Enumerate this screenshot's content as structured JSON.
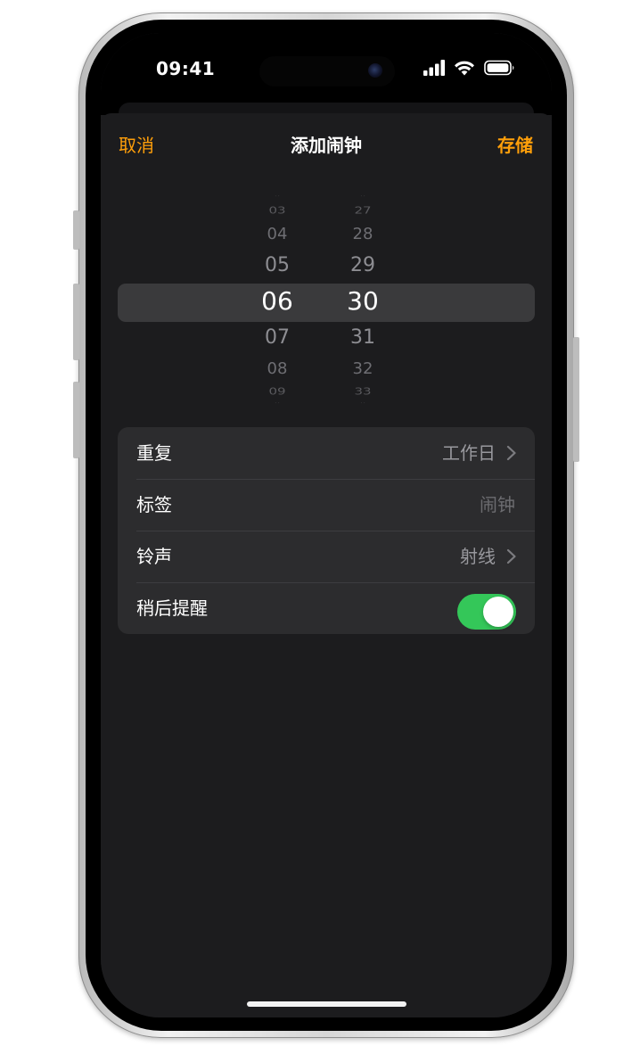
{
  "status_bar": {
    "time": "09:41",
    "icons": [
      "cellular-signal-icon",
      "wifi-icon",
      "battery-icon"
    ]
  },
  "nav": {
    "cancel_label": "取消",
    "title": "添加闹钟",
    "save_label": "存储"
  },
  "time_picker": {
    "hours": [
      "03",
      "04",
      "05",
      "06",
      "07",
      "08",
      "09"
    ],
    "minutes": [
      "27",
      "28",
      "29",
      "30",
      "31",
      "32",
      "33"
    ],
    "selected_hour": "06",
    "selected_minute": "30"
  },
  "settings": {
    "repeat": {
      "label": "重复",
      "value": "工作日"
    },
    "label_row": {
      "label": "标签",
      "placeholder": "闹钟"
    },
    "sound": {
      "label": "铃声",
      "value": "射线"
    },
    "snooze": {
      "label": "稍后提醒",
      "enabled": true
    }
  },
  "colors": {
    "accent": "#ff9f0a",
    "toggle_on": "#34c759",
    "background": "#1c1c1e",
    "cell": "#2c2c2e"
  }
}
